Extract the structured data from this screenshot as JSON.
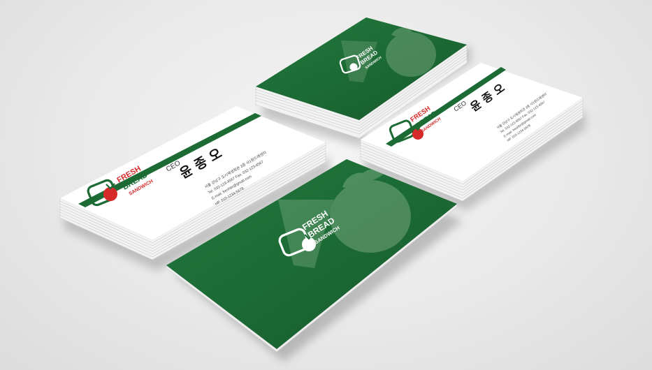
{
  "brand": {
    "line1": "FRESH",
    "line2": "BREAD",
    "line3": "SANDWICH"
  },
  "card": {
    "title": "CEO",
    "name": "윤 종 오",
    "address": "서울 강남구 도시재생회관 3층 사1원드래센터",
    "phone_fax": "Tel. 032-123-4567 Fax. 032-123-4567",
    "email": "E-mail. freshbr@gmail.com",
    "mobile": "HP. 010-1234-5678"
  },
  "colors": {
    "green": "#1c6b35",
    "red": "#d62a2a",
    "white": "#ffffff",
    "background": "#e8e8e8"
  }
}
